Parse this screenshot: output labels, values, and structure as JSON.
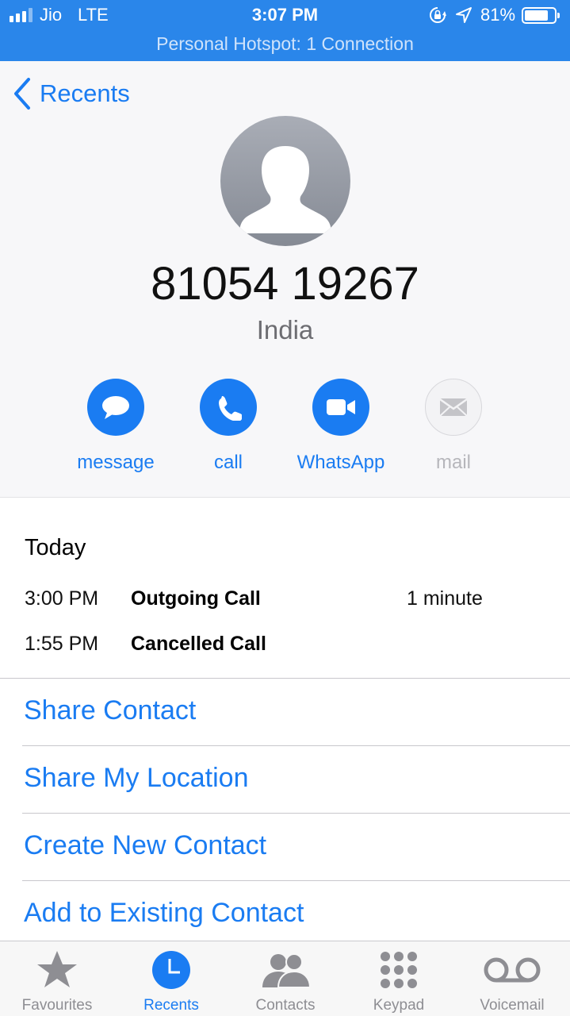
{
  "status_bar": {
    "carrier": "Jio",
    "network": "LTE",
    "time": "3:07 PM",
    "battery": "81%",
    "hotspot": "Personal Hotspot: 1 Connection"
  },
  "nav": {
    "back_label": "Recents"
  },
  "contact": {
    "number": "81054 19267",
    "country": "India"
  },
  "actions": [
    {
      "label": "message",
      "icon": "message-bubble-icon",
      "enabled": true
    },
    {
      "label": "call",
      "icon": "phone-icon",
      "enabled": true
    },
    {
      "label": "WhatsApp",
      "icon": "video-camera-icon",
      "enabled": true
    },
    {
      "label": "mail",
      "icon": "envelope-icon",
      "enabled": false
    }
  ],
  "history": {
    "heading": "Today",
    "calls": [
      {
        "time": "3:00 PM",
        "type": "Outgoing Call",
        "duration": "1 minute"
      },
      {
        "time": "1:55 PM",
        "type": "Cancelled Call",
        "duration": ""
      }
    ]
  },
  "options": [
    "Share Contact",
    "Share My Location",
    "Create New Contact",
    "Add to Existing Contact"
  ],
  "tabs": [
    {
      "label": "Favourites",
      "icon": "star-icon",
      "active": false
    },
    {
      "label": "Recents",
      "icon": "clock-icon",
      "active": true
    },
    {
      "label": "Contacts",
      "icon": "contacts-icon",
      "active": false
    },
    {
      "label": "Keypad",
      "icon": "keypad-icon",
      "active": false
    },
    {
      "label": "Voicemail",
      "icon": "voicemail-icon",
      "active": false
    }
  ],
  "colors": {
    "accent": "#1a7cf2",
    "status_bar": "#2a86ea",
    "inactive": "#8e8e93"
  }
}
